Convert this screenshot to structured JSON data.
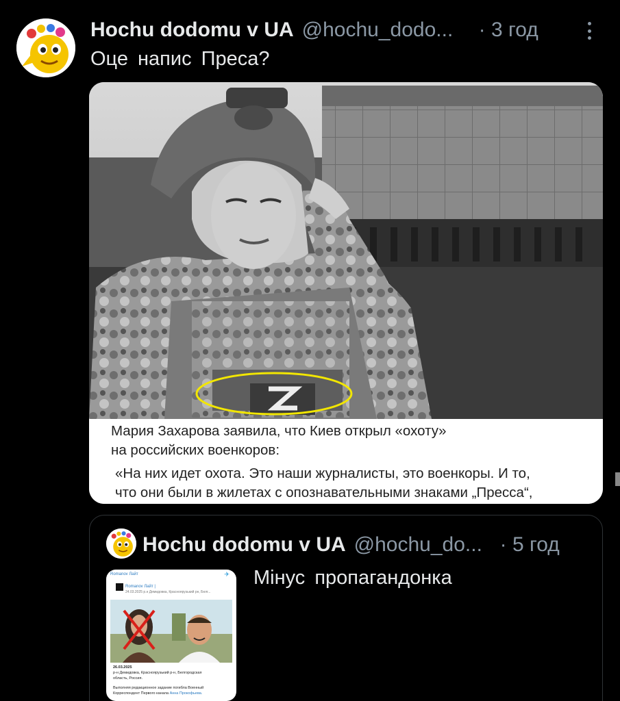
{
  "tweet": {
    "author": "Hochu dodomu v UA",
    "handle": "@hochu_dodo...",
    "time": "· 3 год",
    "text": "Оце напис Преса?",
    "media": {
      "caption_line1": "Мария Захарова заявила, что Киев открыл «охоту»",
      "caption_line2": "на российских военкоров:",
      "caption_line3": "«На них идет охота. Это наши журналисты, это военкоры. И то,",
      "caption_line4": "что они были в жилетах с опознавательными знаками „Пресса“,"
    }
  },
  "quoted": {
    "author": "Hochu dodomu v UA",
    "handle": "@hochu_do...",
    "time": "· 5 год",
    "text": "Мінус пропагандонка",
    "thumb": {
      "channel": "Romanov Лайт",
      "name": "Romanov Лайт |",
      "date": "24.03.2025 р.н Демидовка, Красноярузький рн, Белг...",
      "line1": "26.03.2025",
      "line2": "р-н Демидовка, Красноярузький р-н, Белгородская",
      "line3": "область, Россия.",
      "line4": "Выполняя редакционное задание погибла Военный",
      "line5": "Корреспондент Первого канала",
      "line5_name": "Анна Прокофьева."
    }
  },
  "colors": {
    "background": "#000000",
    "text": "#e7e9ea",
    "muted": "#8b98a5",
    "border": "#2f3336",
    "highlight": "#f2e600"
  }
}
